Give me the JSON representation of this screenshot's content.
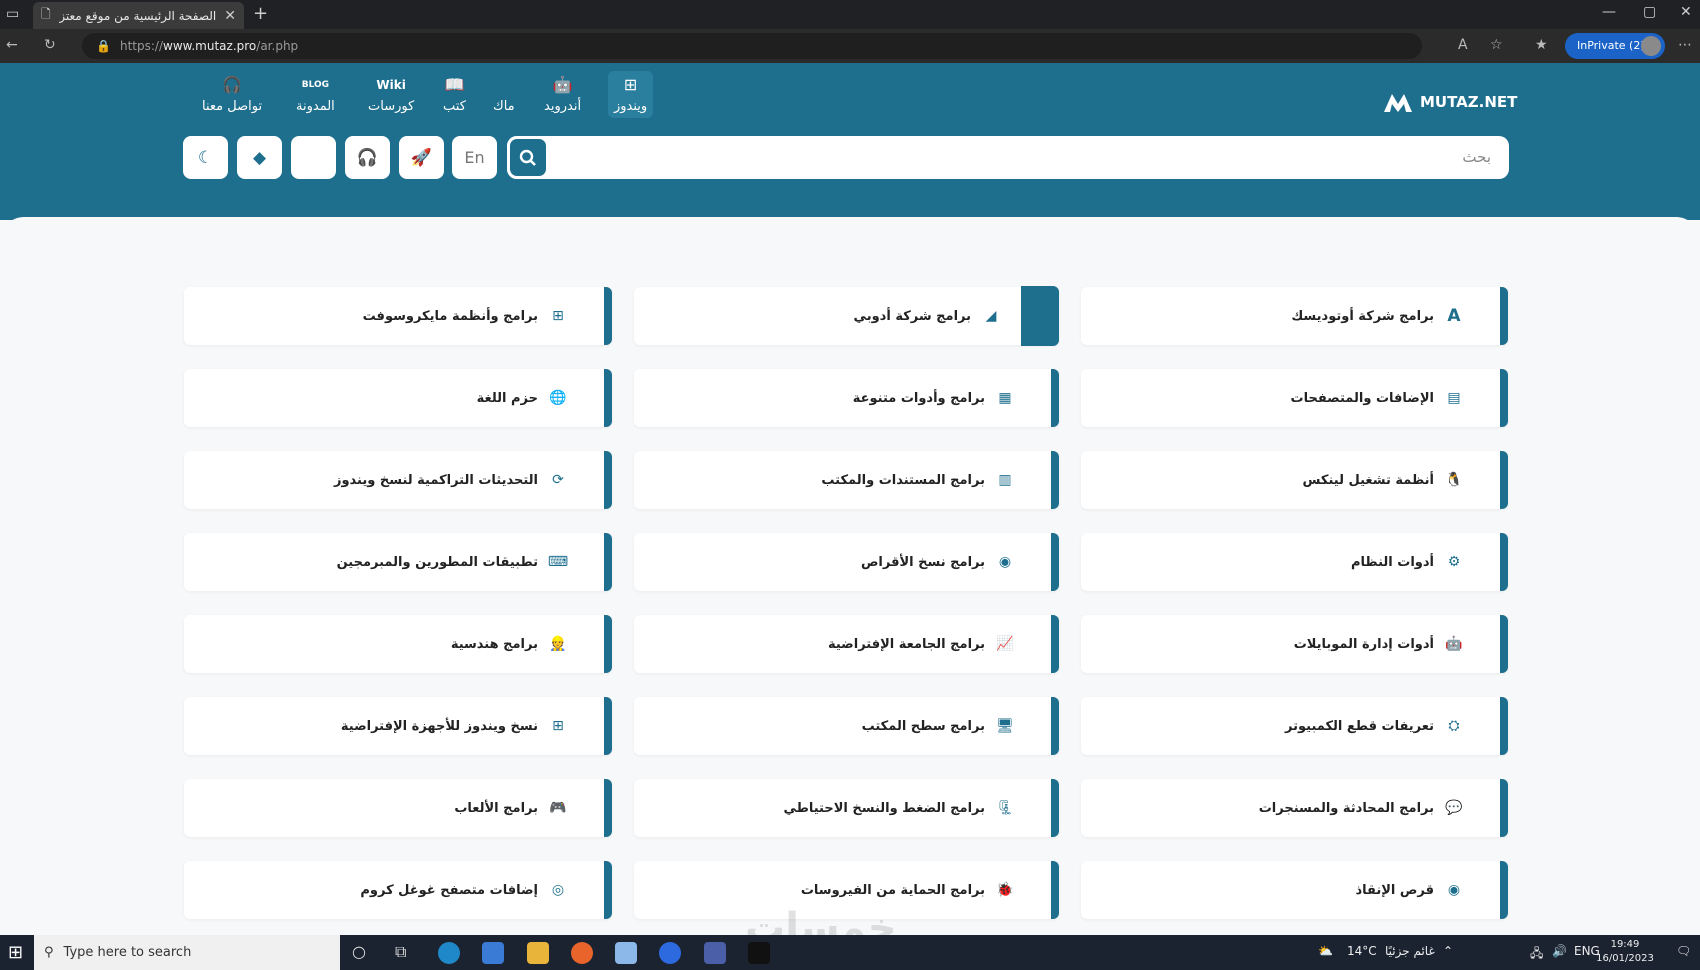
{
  "browser": {
    "tab_title": "الصفحة الرئيسية من موقع معتز للـ",
    "url_prefix": "https://",
    "url_host": "www.mutaz.pro",
    "url_path": "/ar.php",
    "inprivate_label": "InPrivate (2)"
  },
  "site": {
    "logo_text": "MUTAZ.NET",
    "nav": [
      {
        "label": "ويندوز",
        "icon": "windows-icon"
      },
      {
        "label": "أندرويد",
        "icon": "android-icon"
      },
      {
        "label": "ماك",
        "icon": "apple-icon"
      },
      {
        "label": "كتب",
        "icon": "book-icon"
      },
      {
        "label": "كورسات",
        "icon": "wiki-icon",
        "icon_text": "Wiki"
      },
      {
        "label": "المدونة",
        "icon": "blog-icon",
        "icon_text": "BLOG"
      },
      {
        "label": "تواصل معنا",
        "icon": "headset-icon"
      }
    ],
    "search_placeholder": "بحث",
    "lang_button": "En"
  },
  "categories": [
    {
      "label": "برامج شركة أوتوديسك",
      "icon": "autodesk-icon"
    },
    {
      "label": "برامج شركة أدوبي",
      "icon": "adobe-icon"
    },
    {
      "label": "برامج وأنظمة مايكروسوفت",
      "icon": "windows-icon"
    },
    {
      "label": "الإضافات والمتصفحات",
      "icon": "browser-icon"
    },
    {
      "label": "برامج وأدوات متنوعة",
      "icon": "tools-icon"
    },
    {
      "label": "حزم اللغة",
      "icon": "globe-icon"
    },
    {
      "label": "أنظمة تشغيل لينكس",
      "icon": "linux-icon"
    },
    {
      "label": "برامج المستندات والمكتب",
      "icon": "document-icon"
    },
    {
      "label": "التحديثات التراكمية لنسخ ويندوز",
      "icon": "refresh-icon"
    },
    {
      "label": "أدوات النظام",
      "icon": "gears-icon"
    },
    {
      "label": "برامج نسخ الأقراص",
      "icon": "disc-icon"
    },
    {
      "label": "تطبيقات المطورين والمبرمجين",
      "icon": "code-icon"
    },
    {
      "label": "أدوات إدارة الموبايلات",
      "icon": "android-icon"
    },
    {
      "label": "برامج الجامعة الإفتراضية",
      "icon": "chart-icon"
    },
    {
      "label": "برامج هندسية",
      "icon": "engineer-icon"
    },
    {
      "label": "تعريفات قطع الكمبيوتر",
      "icon": "chip-icon"
    },
    {
      "label": "برامج سطح المكتب",
      "icon": "monitor-icon"
    },
    {
      "label": "نسخ ويندوز للأجهزة الإفتراضية",
      "icon": "windows-icon"
    },
    {
      "label": "برامج المحادثة والمسنجرات",
      "icon": "chat-icon"
    },
    {
      "label": "برامج الضغط والنسخ الاحتياطي",
      "icon": "archive-icon"
    },
    {
      "label": "برامج الألعاب",
      "icon": "gamepad-icon"
    },
    {
      "label": "قرص الإنقاذ",
      "icon": "rescue-disc-icon"
    },
    {
      "label": "برامج الحماية من الفيروسات",
      "icon": "bug-icon"
    },
    {
      "label": "إضافات متصفح غوغل كروم",
      "icon": "chrome-icon"
    }
  ],
  "watermark": "خمسات",
  "taskbar": {
    "search_placeholder": "Type here to search",
    "weather": "14°C",
    "weather_text": "غائم جزئيًا",
    "lang": "ENG",
    "time": "19:49",
    "date": "16/01/2023"
  }
}
